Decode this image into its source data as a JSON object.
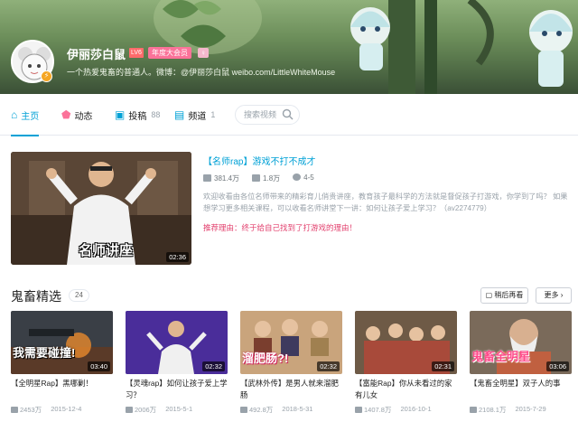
{
  "profile": {
    "username": "伊丽莎白鼠",
    "level_badge": "LV6",
    "vip_badge": "年度大会员",
    "gender_icon": "female-icon",
    "signature": "一个热爱鬼畜的普通人。微博：@伊丽莎白鼠 weibo.com/LittleWhiteMouse"
  },
  "nav": {
    "home": {
      "label": "主页"
    },
    "dynamic": {
      "label": "动态"
    },
    "submissions": {
      "label": "投稿",
      "count": "88"
    },
    "channels": {
      "label": "频道",
      "count": "1"
    },
    "search_placeholder": "搜索视频"
  },
  "highlight": {
    "title": "【名师rap】游戏不打不成才",
    "duration": "02:36",
    "overlay_text": "名师讲座",
    "plays": "381.4万",
    "danmaku": "1.8万",
    "coins": "4-5",
    "description": "欢迎收看由各位名师带来的精彩育儿俏贵讲座，教育孩子最科学的方法就是督促孩子打游戏，你学到了吗？ 如果想学习更多相关课程，可以收看名师讲堂下一讲：如何让孩子爱上学习？（av2274779）",
    "recommend": "推荐理由：终于给自己找到了打游戏的理由！"
  },
  "section": {
    "title": "鬼畜精选",
    "count": "24",
    "watch_later": "稍后再看",
    "more": "更多"
  },
  "videos": [
    {
      "title": "【全明星Rap】黑哪剿！",
      "duration": "03:40",
      "plays": "2453万",
      "date": "2015-12-4",
      "caption": "我需要碰撞!"
    },
    {
      "title": "【灵魂rap】如何让孩子爱上学习？",
      "duration": "02:32",
      "plays": "2006万",
      "date": "2015-5-1",
      "caption": ""
    },
    {
      "title": "【武林外传】是男人就来溜肥肠",
      "duration": "02:32",
      "plays": "492.8万",
      "date": "2018-5-31",
      "caption": "溜肥肠?!"
    },
    {
      "title": "【富能Rap】你从未看过的家有儿女",
      "duration": "02:31",
      "plays": "1407.8万",
      "date": "2016-10-1",
      "caption": ""
    },
    {
      "title": "【鬼畜全明星】双子人的事",
      "duration": "03:06",
      "plays": "2108.1万",
      "date": "2015-7-29",
      "caption": "鬼畜全明星"
    }
  ]
}
